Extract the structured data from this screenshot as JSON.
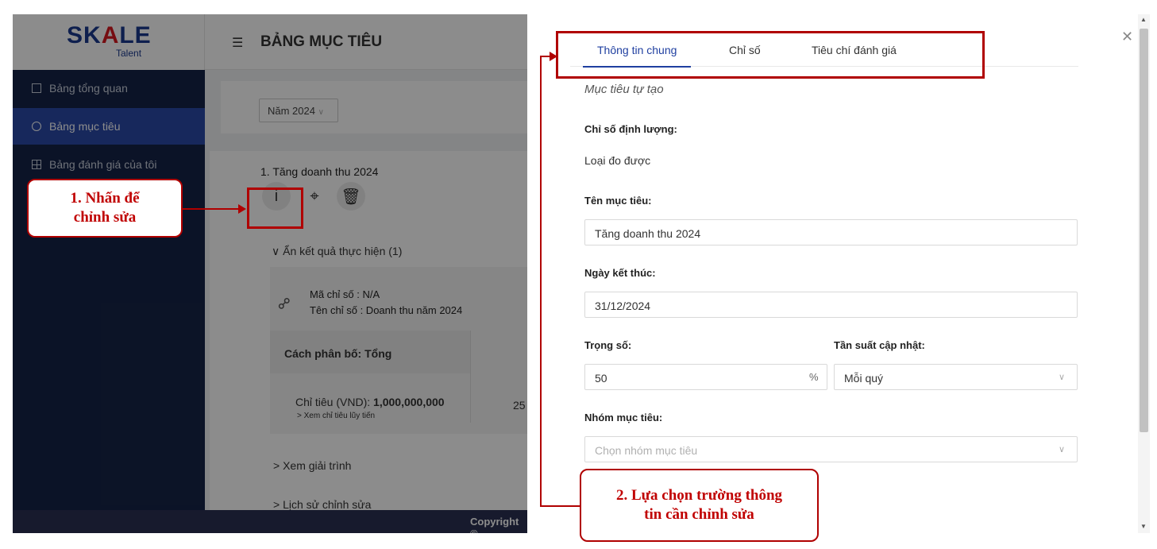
{
  "app": {
    "logo_main_left": "SK",
    "logo_main_a": "A",
    "logo_main_right": "LE",
    "logo_sub": "Talent",
    "menu_icon": "hamburger-icon",
    "page_title": "BẢNG MỤC TIÊU",
    "sidebar": [
      {
        "label": "Bảng tổng quan",
        "icon": "dashboard-icon"
      },
      {
        "label": "Bảng mục tiêu",
        "icon": "target-icon",
        "active": true
      },
      {
        "label": "Bảng đánh giá của tôi",
        "icon": "table-icon"
      }
    ],
    "year_select": "Năm 2024",
    "goal_title": "1. Tăng doanh thu 2024",
    "goal_actions": [
      "info-icon",
      "crosshair-icon",
      "trash-icon"
    ],
    "results_toggle": "∨ Ẩn kết quả thực hiện (1)",
    "kpi_code": "Mã chỉ số : N/A",
    "kpi_name": "Tên chỉ số : Doanh thu năm 2024",
    "distribution": "Cách phân bố: Tổng",
    "target_label": "Chỉ tiêu (VND): ",
    "target_value": "1,000,000,000",
    "cumulative_link": "> Xem chỉ tiêu lũy tiến",
    "partial_value": "25",
    "explain_link": "> Xem giải trình",
    "history_link": "> Lịch sử chỉnh sửa",
    "footer": "Copyright ©"
  },
  "drawer": {
    "tabs": [
      "Thông tin chung",
      "Chỉ số",
      "Tiêu chí đánh giá"
    ],
    "active_tab": 0,
    "goal_type": "Mục tiêu tự tạo",
    "quant_label": "Chỉ số định lượng:",
    "quant_value": "Loại đo được",
    "name_label": "Tên mục tiêu:",
    "name_value": "Tăng doanh thu 2024",
    "end_label": "Ngày kết thúc:",
    "end_value": "31/12/2024",
    "weight_label": "Trọng số:",
    "weight_value": "50",
    "weight_suffix": "%",
    "freq_label": "Tần suất cập nhật:",
    "freq_value": "Mỗi quý",
    "group_label": "Nhóm mục tiêu:",
    "group_placeholder": "Chọn nhóm mục tiêu",
    "close_icon": "close-icon"
  },
  "annotations": {
    "callout1_line1": "1. Nhấn để",
    "callout1_line2": "chỉnh sửa",
    "callout2_line1": "2. Lựa chọn trường thông",
    "callout2_line2": "tin cần chỉnh sửa",
    "color": "#b00000"
  }
}
